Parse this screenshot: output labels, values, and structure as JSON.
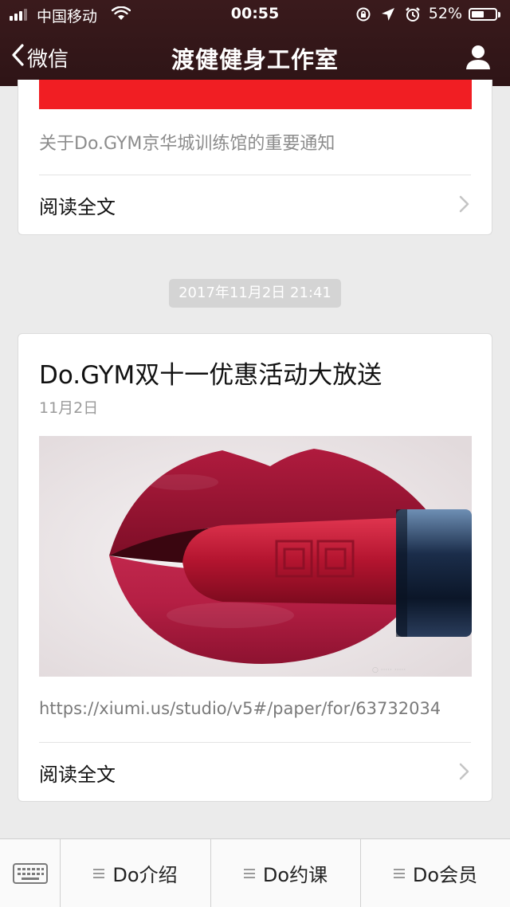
{
  "status_bar": {
    "carrier": "中国移动",
    "time": "00:55",
    "battery_percent": "52%",
    "battery_level": 0.52,
    "icons": [
      "signal-icon",
      "wifi-icon",
      "rotation-lock-icon",
      "location-icon",
      "alarm-icon",
      "battery-icon"
    ]
  },
  "nav": {
    "back_label": "微信",
    "title": "渡健健身工作室",
    "profile_icon": "person-icon"
  },
  "messages": [
    {
      "description": "关于Do.GYM京华城训练馆的重要通知",
      "read_more": "阅读全文",
      "banner_color": "#f11e23"
    },
    {
      "timestamp": "2017年11月2日  21:41",
      "title": "Do.GYM双十一优惠活动大放送",
      "date": "11月2日",
      "cover_icon": "lipstick-photo",
      "url": "https://xiumi.us/studio/v5#/paper/for/63732034",
      "read_more": "阅读全文"
    }
  ],
  "bottom_menu": {
    "keyboard_icon": "keyboard-icon",
    "items": [
      {
        "label": "Do介绍"
      },
      {
        "label": "Do约课"
      },
      {
        "label": "Do会员"
      }
    ]
  },
  "colors": {
    "nav_background": "#2e1416",
    "accent_red": "#f11e23",
    "page_background": "#ebebeb"
  }
}
